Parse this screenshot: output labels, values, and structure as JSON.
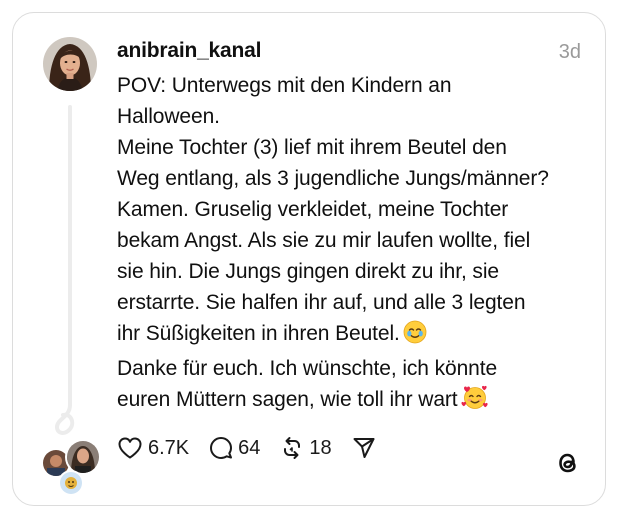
{
  "post": {
    "username": "anibrain_kanal",
    "timestamp": "3d",
    "lines": [
      "POV: Unterwegs mit den Kindern an",
      "Halloween.",
      "Meine Tochter (3) lief mit ihrem Beutel den",
      "Weg entlang, als 3 jugendliche Jungs/männer?",
      "Kamen. Gruselig verkleidet, meine Tochter",
      "bekam Angst. Als sie zu mir laufen wollte, fiel",
      "sie hin. Die Jungs gingen direkt zu ihr, sie",
      "erstarrte. Sie halfen ihr auf, und alle 3 legten",
      "ihr Süßigkeiten in ihren Beutel.",
      "Danke für euch. Ich wünschte, ich könnte",
      "euren Müttern sagen, wie toll ihr wart"
    ],
    "emojis": {
      "line_9": "teary-smile-emoji",
      "line_11": "smiling-face-with-hearts-emoji"
    }
  },
  "actions": {
    "likes": "6.7K",
    "replies": "64",
    "reposts": "18"
  },
  "icons": {
    "like": "heart-icon",
    "reply": "speech-bubble-icon",
    "repost": "repost-icon",
    "share": "paper-plane-icon",
    "brand": "threads-logo-icon"
  },
  "colors": {
    "text": "#101010",
    "muted": "#9a9a9a",
    "border": "#dcdcdc",
    "thread_line": "#ececec"
  }
}
